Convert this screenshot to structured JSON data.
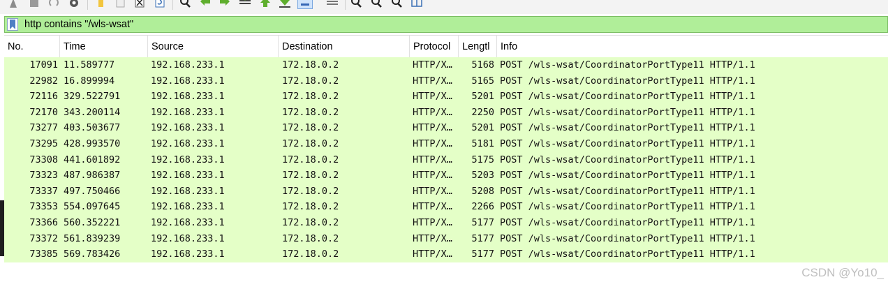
{
  "toolbar": {
    "buttons": [
      "start-capture-icon",
      "stop-capture-icon",
      "restart-capture-icon",
      "capture-options-icon",
      "open-file-icon",
      "save-file-icon",
      "close-file-icon",
      "reload-file-icon",
      "find-packet-icon",
      "go-back-icon",
      "go-forward-icon",
      "go-to-packet-icon",
      "go-first-icon",
      "go-last-icon",
      "auto-scroll-icon",
      "colorize-icon",
      "zoom-in-icon",
      "zoom-out-icon",
      "zoom-normal-icon",
      "resize-columns-icon"
    ]
  },
  "filter": {
    "value": "http contains \"/wls-wsat\"",
    "bg_color": "#b0ee99"
  },
  "columns": [
    "No.",
    "Time",
    "Source",
    "Destination",
    "Protocol",
    "Lengtl",
    "Info"
  ],
  "packets": [
    {
      "no": "17091",
      "time": "11.589777",
      "src": "192.168.233.1",
      "dst": "172.18.0.2",
      "proto": "HTTP/X…",
      "len": "5168",
      "info": "POST /wls-wsat/CoordinatorPortType11 HTTP/1.1"
    },
    {
      "no": "22982",
      "time": "16.899994",
      "src": "192.168.233.1",
      "dst": "172.18.0.2",
      "proto": "HTTP/X…",
      "len": "5165",
      "info": "POST /wls-wsat/CoordinatorPortType11 HTTP/1.1"
    },
    {
      "no": "72116",
      "time": "329.522791",
      "src": "192.168.233.1",
      "dst": "172.18.0.2",
      "proto": "HTTP/X…",
      "len": "5201",
      "info": "POST /wls-wsat/CoordinatorPortType11 HTTP/1.1"
    },
    {
      "no": "72170",
      "time": "343.200114",
      "src": "192.168.233.1",
      "dst": "172.18.0.2",
      "proto": "HTTP/X…",
      "len": "2250",
      "info": "POST /wls-wsat/CoordinatorPortType11 HTTP/1.1"
    },
    {
      "no": "73277",
      "time": "403.503677",
      "src": "192.168.233.1",
      "dst": "172.18.0.2",
      "proto": "HTTP/X…",
      "len": "5201",
      "info": "POST /wls-wsat/CoordinatorPortType11 HTTP/1.1"
    },
    {
      "no": "73295",
      "time": "428.993570",
      "src": "192.168.233.1",
      "dst": "172.18.0.2",
      "proto": "HTTP/X…",
      "len": "5181",
      "info": "POST /wls-wsat/CoordinatorPortType11 HTTP/1.1"
    },
    {
      "no": "73308",
      "time": "441.601892",
      "src": "192.168.233.1",
      "dst": "172.18.0.2",
      "proto": "HTTP/X…",
      "len": "5175",
      "info": "POST /wls-wsat/CoordinatorPortType11 HTTP/1.1"
    },
    {
      "no": "73323",
      "time": "487.986387",
      "src": "192.168.233.1",
      "dst": "172.18.0.2",
      "proto": "HTTP/X…",
      "len": "5203",
      "info": "POST /wls-wsat/CoordinatorPortType11 HTTP/1.1"
    },
    {
      "no": "73337",
      "time": "497.750466",
      "src": "192.168.233.1",
      "dst": "172.18.0.2",
      "proto": "HTTP/X…",
      "len": "5208",
      "info": "POST /wls-wsat/CoordinatorPortType11 HTTP/1.1"
    },
    {
      "no": "73353",
      "time": "554.097645",
      "src": "192.168.233.1",
      "dst": "172.18.0.2",
      "proto": "HTTP/X…",
      "len": "2266",
      "info": "POST /wls-wsat/CoordinatorPortType11 HTTP/1.1"
    },
    {
      "no": "73366",
      "time": "560.352221",
      "src": "192.168.233.1",
      "dst": "172.18.0.2",
      "proto": "HTTP/X…",
      "len": "5177",
      "info": "POST /wls-wsat/CoordinatorPortType11 HTTP/1.1"
    },
    {
      "no": "73372",
      "time": "561.839239",
      "src": "192.168.233.1",
      "dst": "172.18.0.2",
      "proto": "HTTP/X…",
      "len": "5177",
      "info": "POST /wls-wsat/CoordinatorPortType11 HTTP/1.1"
    },
    {
      "no": "73385",
      "time": "569.783426",
      "src": "192.168.233.1",
      "dst": "172.18.0.2",
      "proto": "HTTP/X…",
      "len": "5177",
      "info": "POST /wls-wsat/CoordinatorPortType11 HTTP/1.1"
    }
  ],
  "row_color": "#e4ffc7",
  "watermark": "CSDN @Yo10_"
}
